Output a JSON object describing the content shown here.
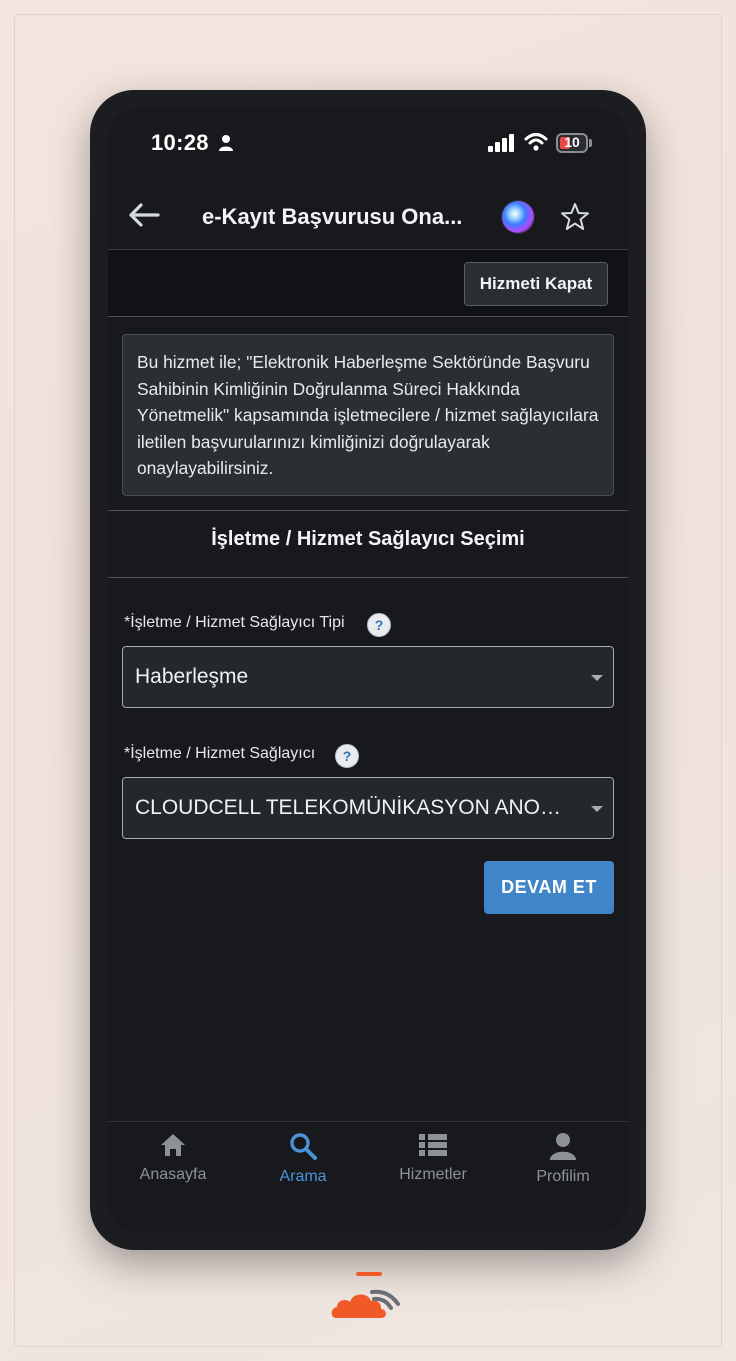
{
  "status_bar": {
    "time": "10:28",
    "battery_level": "10"
  },
  "header": {
    "title": "e-Kayıt Başvurusu Ona..."
  },
  "toolbar": {
    "close_service_label": "Hizmeti Kapat"
  },
  "info": {
    "text": "Bu hizmet ile; \"Elektronik Haberleşme Sektöründe Başvuru Sahibinin Kimliğinin Doğrulanma Süreci Hakkında Yönetmelik\" kapsamında işletmecilere / hizmet sağlayıcılara iletilen başvurularınızı kimliğinizi doğrulayarak onaylayabilirsiniz."
  },
  "section": {
    "title": "İşletme / Hizmet Sağlayıcı Seçimi"
  },
  "form": {
    "provider_type": {
      "label": "*İşletme / Hizmet Sağlayıcı Tipi",
      "help": "?",
      "value": "Haberleşme"
    },
    "provider": {
      "label": "*İşletme / Hizmet Sağlayıcı",
      "help": "?",
      "value": "CLOUDCELL TELEKOMÜNİKASYON ANONİM ŞİRKETİ"
    },
    "continue_label": "DEVAM ET"
  },
  "bottom_nav": {
    "items": [
      {
        "label": "Anasayfa",
        "icon": "home-icon",
        "active": false
      },
      {
        "label": "Arama",
        "icon": "search-icon",
        "active": true
      },
      {
        "label": "Hizmetler",
        "icon": "list-icon",
        "active": false
      },
      {
        "label": "Profilim",
        "icon": "person-icon",
        "active": false
      }
    ]
  },
  "colors": {
    "accent": "#3f86c9",
    "active_nav": "#4a93d8",
    "background": "#17191c",
    "brand_orange": "#f05a28"
  }
}
